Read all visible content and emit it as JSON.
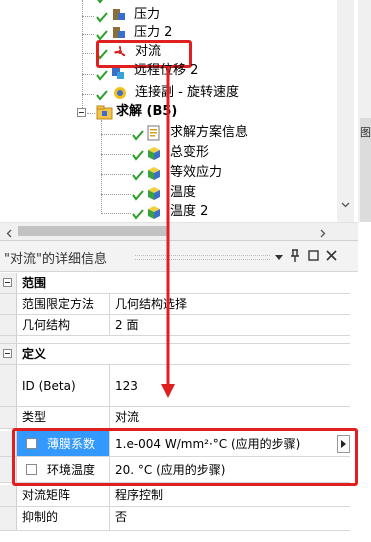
{
  "tree": {
    "items": [
      {
        "label": "压力",
        "level": 3
      },
      {
        "label": "压力 2",
        "level": 3
      },
      {
        "label": "对流",
        "level": 3
      },
      {
        "label": "远程位移 2",
        "level": 3
      },
      {
        "label": "连接副 - 旋转速度",
        "level": 3
      },
      {
        "label": "求解 (B5)",
        "level": 2
      },
      {
        "label": "求解方案信息",
        "level": 3
      },
      {
        "label": "总变形",
        "level": 3
      },
      {
        "label": "等效应力",
        "level": 3
      },
      {
        "label": "温度",
        "level": 3
      },
      {
        "label": "温度 2",
        "level": 3
      }
    ],
    "side_tab_letter": "图"
  },
  "details": {
    "title": "\"对流\"的详细信息",
    "title_icons": [
      "pin-icon",
      "restore-icon",
      "close-icon"
    ],
    "groups": [
      {
        "name": "范围",
        "rows": [
          {
            "label": "范围限定方法",
            "value": "几何结构选择"
          },
          {
            "label": "几何结构",
            "value": "2 面"
          }
        ]
      },
      {
        "name": "定义",
        "rows": [
          {
            "label": "ID (Beta)",
            "value": "123"
          },
          {
            "label": "类型",
            "value": "对流"
          },
          {
            "label": "薄膜系数",
            "value": "1.e-004 W/mm²·°C  (应用的步骤)"
          },
          {
            "label": "环境温度",
            "value": "20. °C  (应用的步骤)"
          },
          {
            "label": "对流矩阵",
            "value": "程序控制"
          },
          {
            "label": "抑制的",
            "value": "否"
          }
        ]
      }
    ]
  },
  "colors": {
    "annotation_red": "#e02020",
    "selection_blue": "#3399ff",
    "header_bg": "#f3f3f3"
  }
}
